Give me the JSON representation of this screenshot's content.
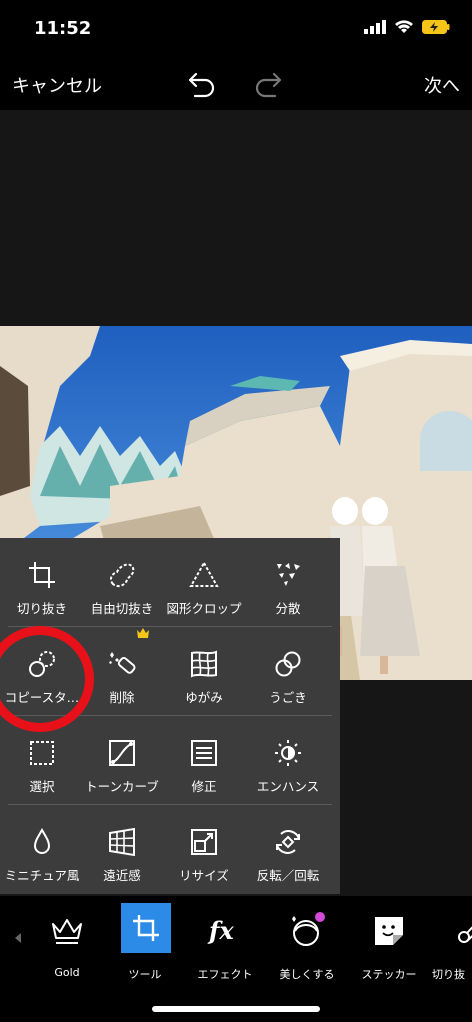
{
  "status": {
    "time": "11:52"
  },
  "topbar": {
    "cancel": "キャンセル",
    "next": "次へ"
  },
  "tools": [
    [
      "切り抜き",
      "自由切抜き",
      "図形クロップ",
      "分散"
    ],
    [
      "コピースタ…",
      "削除",
      "ゆがみ",
      "うごき"
    ],
    [
      "選択",
      "トーンカーブ",
      "修正",
      "エンハンス"
    ],
    [
      "ミニチュア風",
      "遠近感",
      "リサイズ",
      "反転／回転"
    ]
  ],
  "bottom": {
    "gold": "Gold",
    "tool": "ツール",
    "effect": "エフェクト",
    "beautify": "美しくする",
    "sticker": "ステッカー",
    "cutout": "切り抜"
  },
  "colors": {
    "panel": "#3c3c3c",
    "highlight": "#e8111a",
    "accent": "#2b8be6",
    "battery": "#f5c518"
  },
  "icons": {
    "crop": "crop-icon",
    "freecrop": "free-crop-icon",
    "shape": "triangle-icon",
    "disperse": "disperse-icon",
    "clone": "clone-icon",
    "remove": "eraser-icon",
    "warp": "warp-icon",
    "motion": "motion-icon",
    "select": "select-icon",
    "curves": "curves-icon",
    "adjust": "adjust-icon",
    "enhance": "enhance-icon",
    "tiltshift": "tilt-shift-icon",
    "perspective": "perspective-icon",
    "resize": "resize-icon",
    "flip": "flip-rotate-icon"
  }
}
